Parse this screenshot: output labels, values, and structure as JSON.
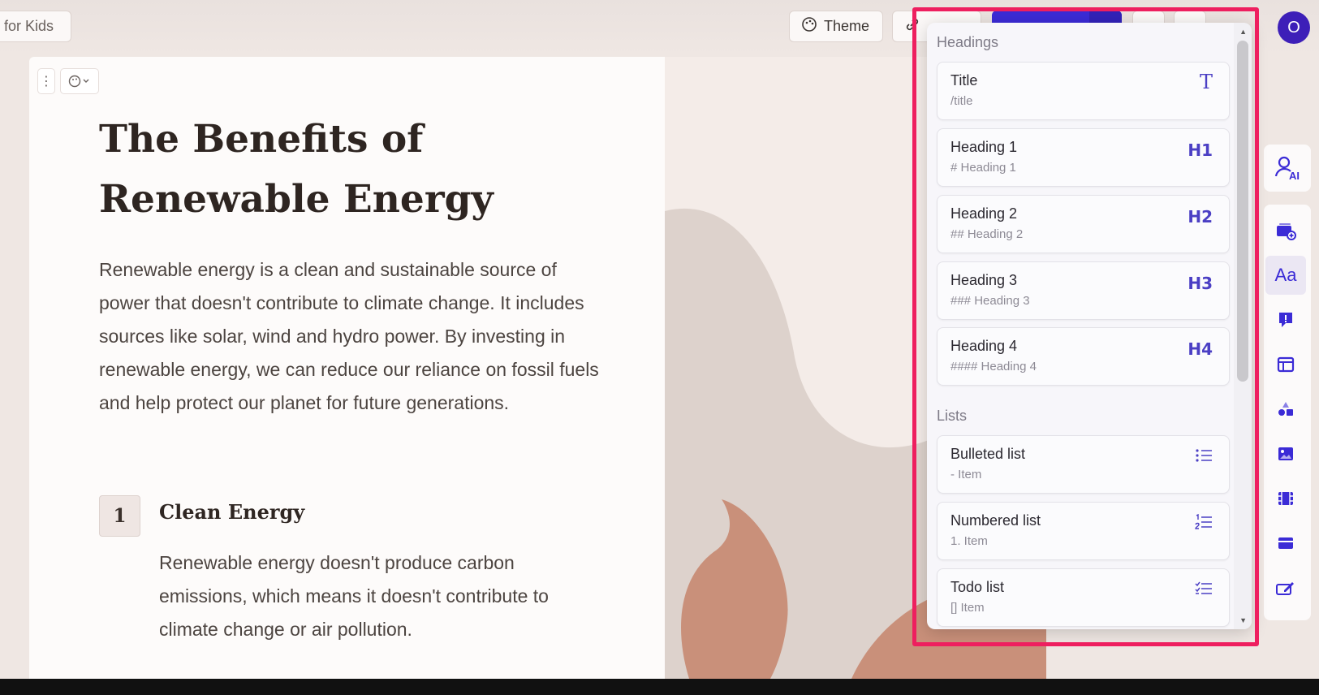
{
  "topbar": {
    "doc_title": "for Kids",
    "theme_label": "Theme",
    "share_label": "Share",
    "avatar_initial": "O"
  },
  "card": {
    "title": "The Benefits of Renewable Energy",
    "body": "Renewable energy is a clean and sustainable source of power that doesn't contribute to climate change. It includes sources like solar, wind and hydro power. By investing in renewable energy, we can reduce our reliance on fossil fuels and help protect our planet for future generations.",
    "item_number": "1",
    "item_heading": "Clean Energy",
    "item_text": "Renewable energy doesn't produce carbon emissions, which means it doesn't contribute to climate change or air pollution."
  },
  "menu": {
    "headings_label": "Headings",
    "lists_label": "Lists",
    "headings": [
      {
        "label": "Title",
        "hint": "/title",
        "icon": "T"
      },
      {
        "label": "Heading 1",
        "hint": "# Heading 1",
        "icon": "H1"
      },
      {
        "label": "Heading 2",
        "hint": "## Heading 2",
        "icon": "H2"
      },
      {
        "label": "Heading 3",
        "hint": "### Heading 3",
        "icon": "H3"
      },
      {
        "label": "Heading 4",
        "hint": "#### Heading 4",
        "icon": "H4"
      }
    ],
    "lists": [
      {
        "label": "Bulleted list",
        "hint": "- Item",
        "icon": "bulleted-list-icon"
      },
      {
        "label": "Numbered list",
        "hint": "1. Item",
        "icon": "numbered-list-icon"
      },
      {
        "label": "Todo list",
        "hint": "[] Item",
        "icon": "todo-list-icon"
      }
    ]
  },
  "rail": {
    "ai_label": "AI",
    "text_icon_label": "Aa"
  },
  "colors": {
    "accent": "#3b2bd6",
    "highlight": "#ee1f5f",
    "shape_beige": "#ddd2cc",
    "shape_terracotta": "#c9907a"
  }
}
